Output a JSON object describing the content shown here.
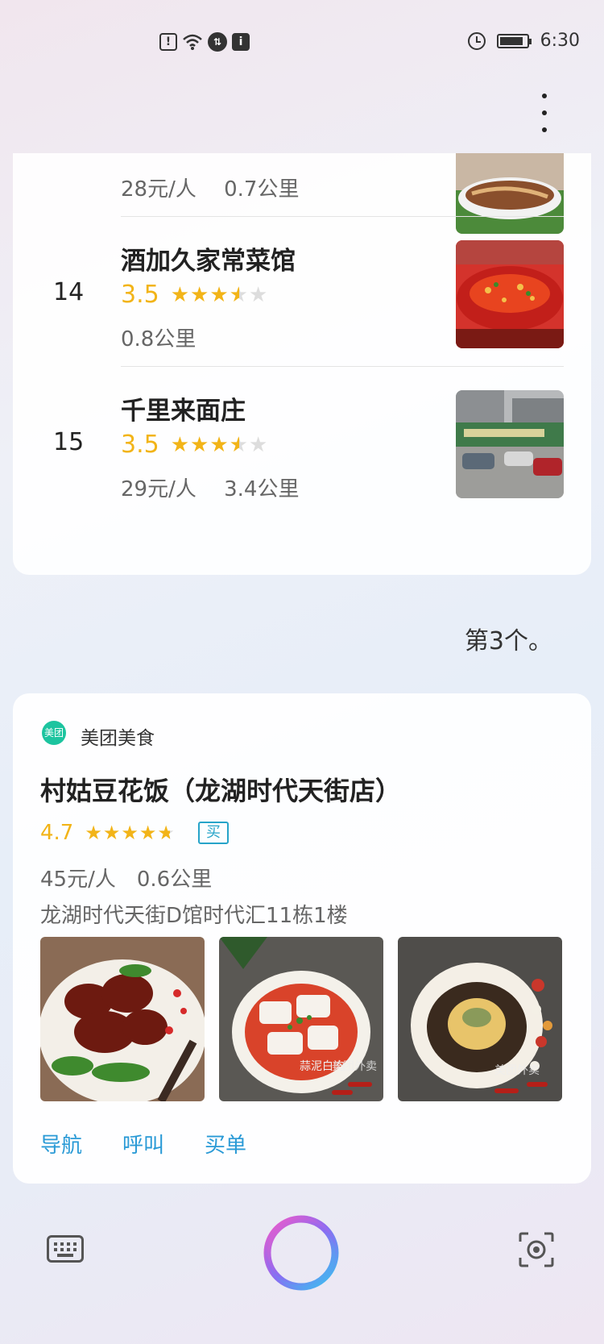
{
  "status_bar": {
    "time": "6:30",
    "left_icons": [
      "alert-icon",
      "wifi-icon",
      "data-transfer-icon",
      "info-icon"
    ],
    "right_icons": [
      "alarm-icon",
      "battery-icon"
    ]
  },
  "list": {
    "rows": [
      {
        "num": "",
        "name": "",
        "rating": "",
        "meta": "28元/人　 0.7公里",
        "stars": 0
      },
      {
        "num": "14",
        "name": "酒加久家常菜馆",
        "rating": "3.5",
        "meta": "0.8公里",
        "stars": 3.5
      },
      {
        "num": "15",
        "name": "千里来面庄",
        "rating": "3.5",
        "meta": "29元/人　 3.4公里",
        "stars": 3.5
      }
    ]
  },
  "assistant_reply": "第3个。",
  "detail": {
    "source": "美团美食",
    "source_logo_text": "美团",
    "title": "村姑豆花饭（龙湖时代天街店）",
    "rating": "4.7",
    "stars": 4.7,
    "badge": "买",
    "price_distance": "45元/人　0.6公里",
    "address": "龙湖时代天街D馆时代汇11栋1楼",
    "photo_caption": "蒜泥白肉",
    "photo_watermark": "美团外卖",
    "actions": [
      "导航",
      "呼叫",
      "买单"
    ]
  },
  "colors": {
    "star": "#f2b418",
    "link": "#2a9ad6",
    "badge": "#27a4c9",
    "logo": "#1cc49f"
  }
}
